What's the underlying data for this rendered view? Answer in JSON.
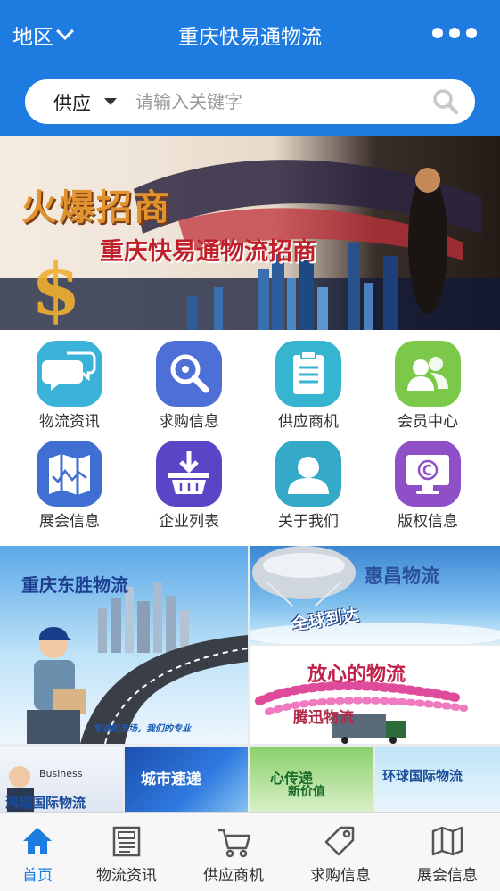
{
  "header": {
    "region_label": "地区",
    "app_title": "重庆快易通物流"
  },
  "search": {
    "category": "供应",
    "placeholder": "请输入关键字"
  },
  "banner": {
    "tagline": "火爆招商",
    "subtitle": "重庆快易通物流招商"
  },
  "grid": {
    "items": [
      {
        "label": "物流资讯",
        "icon": "chat-bubbles-icon",
        "color": "#3bb3d9"
      },
      {
        "label": "求购信息",
        "icon": "magnifier-icon",
        "color": "#4d6fd6"
      },
      {
        "label": "供应商机",
        "icon": "clipboard-icon",
        "color": "#35b5cf"
      },
      {
        "label": "会员中心",
        "icon": "users-icon",
        "color": "#7cc94a"
      },
      {
        "label": "展会信息",
        "icon": "map-icon",
        "color": "#3f6fd3"
      },
      {
        "label": "企业列表",
        "icon": "download-basket-icon",
        "color": "#5b45c7"
      },
      {
        "label": "关于我们",
        "icon": "person-icon",
        "color": "#35a9c8"
      },
      {
        "label": "版权信息",
        "icon": "copyright-monitor-icon",
        "color": "#8f4fc6"
      }
    ]
  },
  "promos": {
    "tile1": {
      "title": "重庆东胜物流",
      "slogan": "专业的市场，我们的专业"
    },
    "tile2": {
      "title": "惠昌物流",
      "slogan": "全球到达"
    },
    "tile3": {
      "title": "放心的物流",
      "slogan": "腾迅物流"
    },
    "tile4": {
      "title": "Business",
      "slogan": "鸿瑞国际物流"
    },
    "tile5": {
      "title": "城市速递"
    },
    "tile6": {
      "title": "心传递",
      "slogan": "新价值"
    },
    "tile7": {
      "title": "环球国际物流"
    }
  },
  "tabbar": {
    "tabs": [
      {
        "label": "首页",
        "icon": "home-icon"
      },
      {
        "label": "物流资讯",
        "icon": "news-icon"
      },
      {
        "label": "供应商机",
        "icon": "cart-icon"
      },
      {
        "label": "求购信息",
        "icon": "tag-icon"
      },
      {
        "label": "展会信息",
        "icon": "map-icon"
      }
    ],
    "active_color": "#1e7be0"
  }
}
